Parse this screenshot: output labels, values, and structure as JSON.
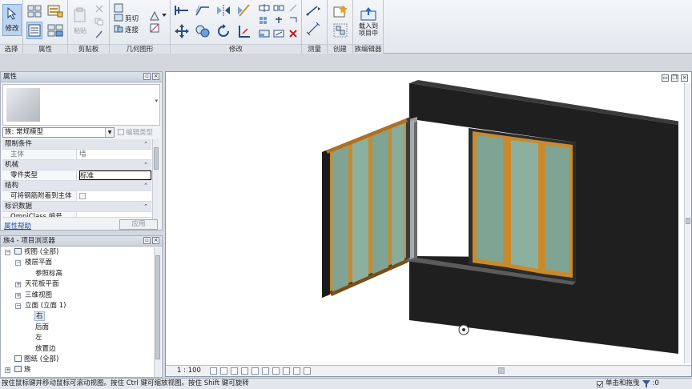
{
  "ribbon": {
    "panels": {
      "select": "选择",
      "properties": "属性",
      "clipboard": "剪贴板",
      "geometry": "几何图形",
      "modify": "修改",
      "measure": "测量",
      "create": "创建",
      "family_editor": "族编辑器"
    },
    "modify_button": "修改",
    "paste_button": "粘贴",
    "cut_label": "剪切",
    "join_label": "连接",
    "load_into_project": "载入到\n项目中",
    "load_line1": "载入到",
    "load_line2": "项目中"
  },
  "properties": {
    "title": "属性",
    "type_selector": "族: 常规模型",
    "edit_type": "编辑类型",
    "rows": {
      "constraints": "限制条件",
      "host_label": "主体",
      "host_value": "墙",
      "mechanical": "机械",
      "part_type_label": "零件类型",
      "part_type_value": "标准",
      "structure": "结构",
      "rebar_label": "可将钢筋附着到主体",
      "identity": "标识数据",
      "omniclass_label": "OmniClass 编号"
    },
    "help": "属性帮助",
    "apply": "应用"
  },
  "browser": {
    "title": "族4 - 项目浏览器",
    "nodes": [
      {
        "label": "视图 (全部)",
        "level": 0,
        "exp": "-",
        "icon": "views"
      },
      {
        "label": "楼层平面",
        "level": 1,
        "exp": "-",
        "icon": "none"
      },
      {
        "label": "参照标高",
        "level": 2,
        "exp": "",
        "icon": "none"
      },
      {
        "label": "天花板平面",
        "level": 1,
        "exp": "+",
        "icon": "none"
      },
      {
        "label": "三维视图",
        "level": 1,
        "exp": "+",
        "icon": "none"
      },
      {
        "label": "立面 (立面 1)",
        "level": 1,
        "exp": "-",
        "icon": "none"
      },
      {
        "label": "右",
        "level": 2,
        "exp": "",
        "icon": "none",
        "selected": true
      },
      {
        "label": "后面",
        "level": 2,
        "exp": "",
        "icon": "none"
      },
      {
        "label": "左",
        "level": 2,
        "exp": "",
        "icon": "none"
      },
      {
        "label": "放置边",
        "level": 2,
        "exp": "",
        "icon": "none"
      },
      {
        "label": "图纸 (全部)",
        "level": 0,
        "exp": "",
        "icon": "sheet"
      },
      {
        "label": "族",
        "level": 0,
        "exp": "+",
        "icon": "family"
      }
    ]
  },
  "view": {
    "scale": "1 : 100"
  },
  "status": {
    "message": "按住鼠标键并移动鼠标可滚动视图。按住 Ctrl 键可缩放视图。按住 Shift 键可旋转",
    "press_drag": "单击和拖曳",
    "filter_count": ":0"
  },
  "colors": {
    "wall": "#1c1c1c",
    "frame": "#c98a2e",
    "glass": "#7fa493",
    "ribbon_active": "#bcd4ef"
  }
}
